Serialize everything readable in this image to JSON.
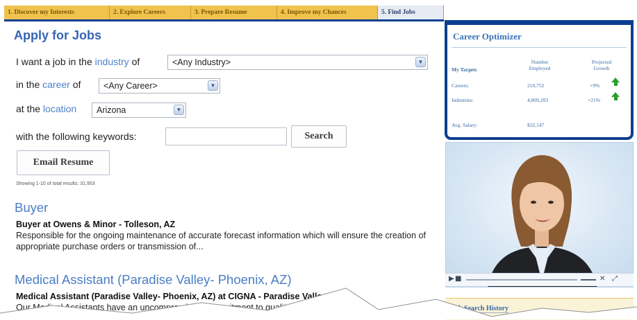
{
  "tabs": [
    {
      "label": "1. Discover my Interests"
    },
    {
      "label": "2. Explore Careers"
    },
    {
      "label": "3. Prepare Resume"
    },
    {
      "label": "4. Improve my Chances"
    },
    {
      "label": "5. Find Jobs"
    }
  ],
  "page_title": "Apply for Jobs",
  "form": {
    "industry_prefix": "I want a job in the",
    "industry_link": "industry",
    "industry_suffix": "of",
    "industry_value": "<Any Industry>",
    "career_prefix": "in the",
    "career_link": "career",
    "career_suffix": "of",
    "career_value": "<Any Career>",
    "location_prefix": "at the",
    "location_link": "location",
    "location_value": "Arizona",
    "keywords_label": "with the following keywords:",
    "keywords_value": "",
    "search_label": "Search",
    "email_label": "Email Resume",
    "showing": "Showing 1-10 of total results: 31,953"
  },
  "jobs": [
    {
      "title": "Buyer",
      "subtitle": "Buyer at Owens & Minor - Tolleson, AZ",
      "description": "Responsible for the ongoing maintenance of accurate forecast information which will ensure the creation of appropriate purchase orders or transmission of..."
    },
    {
      "title": "Medical Assistant (Paradise Valley- Phoenix, AZ)",
      "subtitle": "Medical Assistant (Paradise Valley- Phoenix, AZ) at CIGNA - Paradise Valley, AZ",
      "description": "Our Medical Assistants have an uncompromising commitment to quality health"
    }
  ],
  "optimizer": {
    "title": "Career Optimizer",
    "col_targets": "My Targets",
    "col_employed": "Number Employed",
    "col_growth": "Projected Growth",
    "rows": [
      {
        "label": "Careers:",
        "employed": "210,752",
        "growth": "+9%"
      },
      {
        "label": "Industries:",
        "employed": "4,809,203",
        "growth": "+21%"
      }
    ],
    "salary_label": "Avg. Salary:",
    "salary_value": "$32,147",
    "growth_color": "#2aa02a"
  },
  "history": {
    "title": "Job Search History"
  }
}
